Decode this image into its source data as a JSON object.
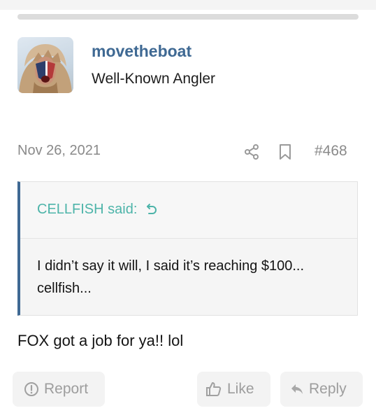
{
  "author": {
    "username": "movetheboat",
    "user_title": "Well-Known Angler"
  },
  "post": {
    "date": "Nov 26, 2021",
    "number": "#468",
    "message": "FOX got a job for ya!! lol"
  },
  "quote": {
    "attribution": "CELLFISH said:",
    "text": "I didn’t say it will, I said it’s reaching $100... cellfish..."
  },
  "actions": {
    "report_label": "Report",
    "like_label": "Like",
    "reply_label": "Reply"
  },
  "icons": {
    "share": "share-icon",
    "bookmark": "bookmark-icon",
    "quote_return": "return-arrow-icon",
    "report": "exclamation-circle-icon",
    "like": "thumbs-up-icon",
    "reply": "reply-arrow-icon"
  },
  "colors": {
    "username": "#3f6993",
    "quote_attribution": "#4db4a9",
    "quote_border": "#3f6993",
    "muted_text": "#8a8a8a"
  }
}
